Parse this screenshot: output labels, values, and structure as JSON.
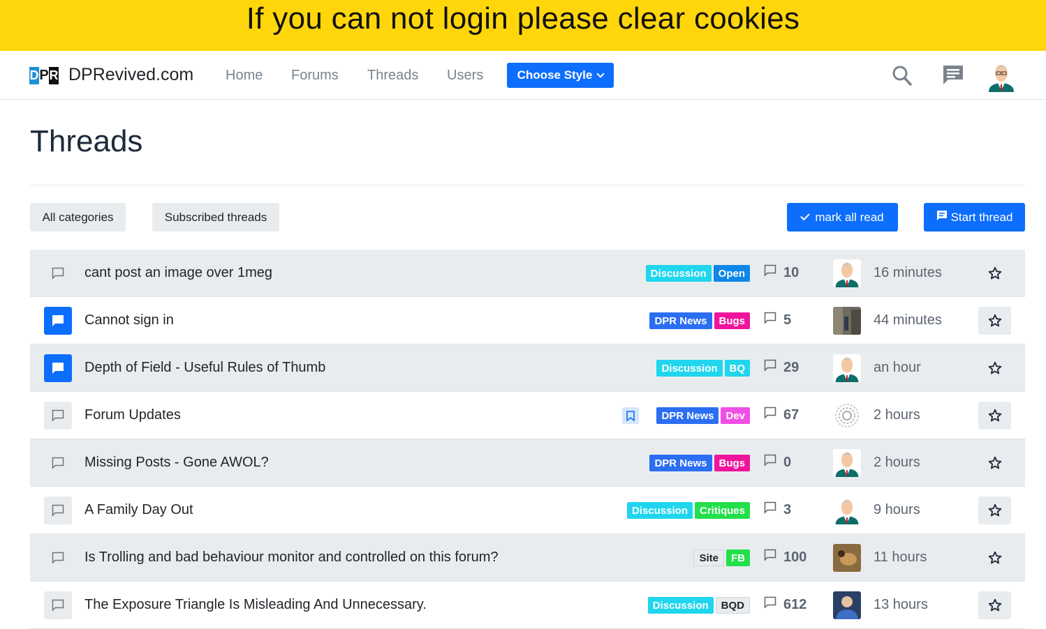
{
  "banner": {
    "text": "If you can not login please clear cookies"
  },
  "header": {
    "logo_letters": [
      "D",
      "P",
      "R"
    ],
    "brand": "DPRevived.com",
    "nav": [
      "Home",
      "Forums",
      "Threads",
      "Users"
    ],
    "style_button": "Choose Style"
  },
  "page": {
    "title": "Threads"
  },
  "toolbar": {
    "all_categories": "All categories",
    "subscribed": "Subscribed threads",
    "mark_read": "mark all read",
    "start_thread": "Start thread"
  },
  "colors": {
    "accent": "#0d6efd",
    "banner": "#ffd60a",
    "tag_discussion": "#1fd6ee",
    "tag_open": "#0d87e8",
    "tag_dpr_news": "#2b6ef2",
    "tag_bugs": "#f0149c",
    "tag_bq": "#1fd6ee",
    "tag_dev": "#f04fe6",
    "tag_critiques": "#22e04a",
    "tag_fb": "#22e04a",
    "tag_site": "#e9ecef"
  },
  "threads": [
    {
      "title": "cant post an image over 1meg",
      "tags": [
        "Discussion",
        "Open"
      ],
      "replies": "10",
      "time": "16 minutes",
      "avatar": "cartoon-man-avatar",
      "unread": false
    },
    {
      "title": "Cannot sign in",
      "tags": [
        "DPR News",
        "Bugs"
      ],
      "replies": "5",
      "time": "44 minutes",
      "avatar": "street-photo-avatar",
      "unread": true
    },
    {
      "title": "Depth of Field - Useful Rules of Thumb",
      "tags": [
        "Discussion",
        "BQ"
      ],
      "replies": "29",
      "time": "an hour",
      "avatar": "cartoon-man-avatar",
      "unread": true
    },
    {
      "title": "Forum Updates",
      "tags": [
        "DPR News",
        "Dev"
      ],
      "replies": "67",
      "time": "2 hours",
      "avatar": "fingerprint-avatar",
      "unread": false,
      "bookmarked": true
    },
    {
      "title": "Missing Posts - Gone AWOL?",
      "tags": [
        "DPR News",
        "Bugs"
      ],
      "replies": "0",
      "time": "2 hours",
      "avatar": "cartoon-man-avatar",
      "unread": false
    },
    {
      "title": "A Family Day Out",
      "tags": [
        "Discussion",
        "Critiques"
      ],
      "replies": "3",
      "time": "9 hours",
      "avatar": "cartoon-man-avatar",
      "unread": false
    },
    {
      "title": "Is Trolling and bad behaviour monitor and controlled on this forum?",
      "tags": [
        "Site",
        "FB"
      ],
      "replies": "100",
      "time": "11 hours",
      "avatar": "bird-photo-avatar",
      "unread": false
    },
    {
      "title": "The Exposure Triangle Is Misleading And Unnecessary.",
      "tags": [
        "Discussion",
        "BQD"
      ],
      "replies": "612",
      "time": "13 hours",
      "avatar": "person-photo-avatar",
      "unread": false
    }
  ]
}
